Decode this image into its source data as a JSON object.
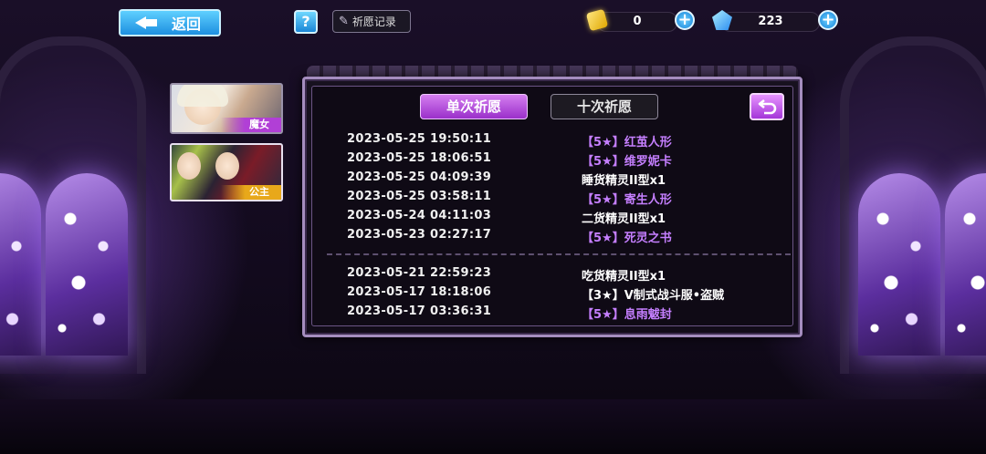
{
  "topbar": {
    "back_label": "返回",
    "help_label": "?",
    "record_label": "祈愿记录",
    "gold_value": "0",
    "gem_value": "223"
  },
  "side_tabs": [
    {
      "label": "魔女"
    },
    {
      "label": "公主"
    }
  ],
  "panel": {
    "tab_single": "单次祈愿",
    "tab_ten": "十次祈愿",
    "records_group1": [
      {
        "time": "2023-05-25 19:50:11",
        "item": "【5★】红茧人形",
        "rarity": "purple"
      },
      {
        "time": "2023-05-25 18:06:51",
        "item": "【5★】维罗妮卡",
        "rarity": "purple"
      },
      {
        "time": "2023-05-25 04:09:39",
        "item": "睡货精灵II型x1",
        "rarity": "white"
      },
      {
        "time": "2023-05-25 03:58:11",
        "item": "【5★】寄生人形",
        "rarity": "purple"
      },
      {
        "time": "2023-05-24 04:11:03",
        "item": "二货精灵II型x1",
        "rarity": "white"
      },
      {
        "time": "2023-05-23 02:27:17",
        "item": "【5★】死灵之书",
        "rarity": "purple"
      }
    ],
    "records_group2": [
      {
        "time": "2023-05-21 22:59:23",
        "item": "吃货精灵II型x1",
        "rarity": "white"
      },
      {
        "time": "2023-05-17 18:18:06",
        "item": "【3★】V制式战斗服•盗贼",
        "rarity": "white"
      },
      {
        "time": "2023-05-17 03:36:31",
        "item": "【5★】息雨魃封",
        "rarity": "purple"
      }
    ]
  },
  "colors": {
    "accent_purple": "#c57fff",
    "button_blue": "#1d8fe0"
  },
  "icons": {
    "back": "left-arrow-icon",
    "help": "question-icon",
    "record": "scroll-icon",
    "gold": "gold-bar-icon",
    "gem": "crystal-icon",
    "add": "plus-icon",
    "return": "return-arrow-icon"
  }
}
